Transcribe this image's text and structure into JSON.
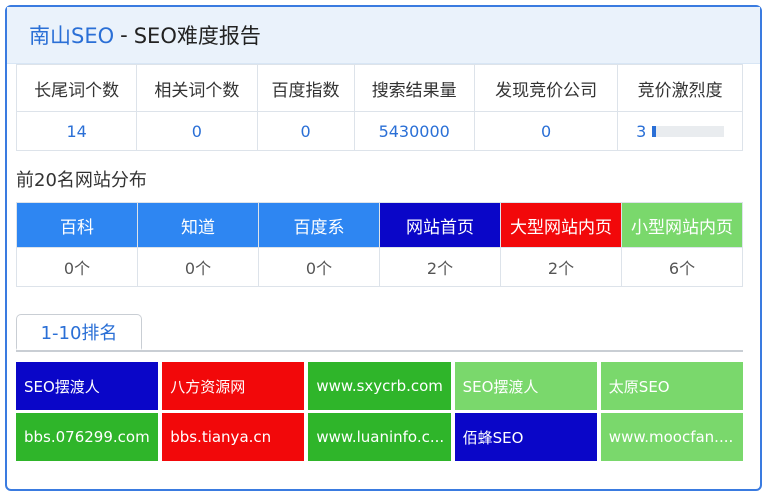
{
  "title": {
    "brand": "南山SEO",
    "separator": "-",
    "text": "SEO难度报告"
  },
  "stats": {
    "headers": [
      "长尾词个数",
      "相关词个数",
      "百度指数",
      "搜索结果量",
      "发现竞价公司",
      "竞价激烈度"
    ],
    "values": [
      "14",
      "0",
      "0",
      "5430000",
      "0",
      "3"
    ],
    "competition_fraction": 0.05
  },
  "distribution": {
    "title": "前20名网站分布",
    "categories": [
      {
        "label": "百科",
        "count": "0个",
        "color": "#2e86f2"
      },
      {
        "label": "知道",
        "count": "0个",
        "color": "#2e86f2"
      },
      {
        "label": "百度系",
        "count": "0个",
        "color": "#2e86f2"
      },
      {
        "label": "网站首页",
        "count": "2个",
        "color": "#0a06c8"
      },
      {
        "label": "大型网站内页",
        "count": "2个",
        "color": "#f2080a"
      },
      {
        "label": "小型网站内页",
        "count": "6个",
        "color": "#7ad86c"
      }
    ]
  },
  "tab": {
    "label": "1-10排名"
  },
  "ranking": [
    {
      "text": "SEO摆渡人",
      "color": "#0a06c8"
    },
    {
      "text": "八方资源网",
      "color": "#f2080a"
    },
    {
      "text": "www.sxycrb.com",
      "color": "#2fb52a"
    },
    {
      "text": "SEO摆渡人",
      "color": "#7ad86c"
    },
    {
      "text": "太原SEO",
      "color": "#7ad86c"
    },
    {
      "text": "bbs.076299.com",
      "color": "#2fb52a"
    },
    {
      "text": "bbs.tianya.cn",
      "color": "#f2080a"
    },
    {
      "text": "www.luaninfo.c...",
      "color": "#2fb52a"
    },
    {
      "text": "佰蜂SEO",
      "color": "#0a06c8"
    },
    {
      "text": "www.moocfan....",
      "color": "#7ad86c"
    }
  ]
}
